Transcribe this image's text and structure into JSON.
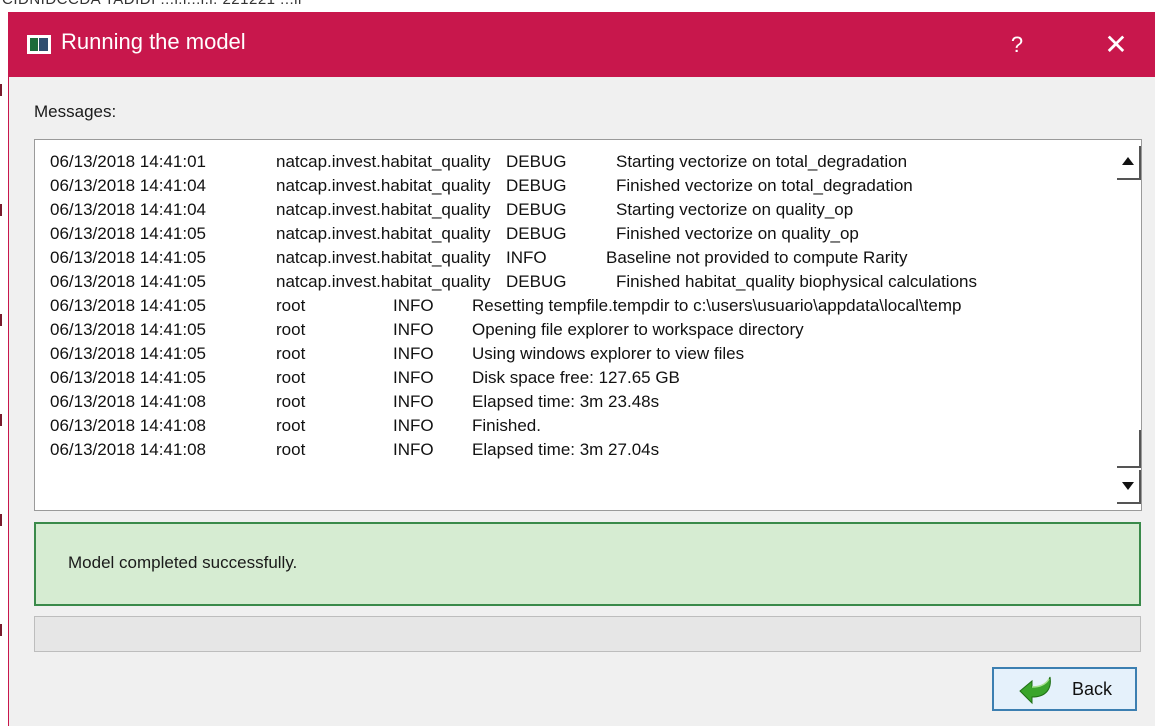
{
  "background_window": {
    "partial_text": "CIDNIDCCDA TADIDI ...l.l...l.l. 221221 ...ll"
  },
  "window": {
    "title": "Running the model",
    "help_label": "?",
    "close_label": "✕",
    "titlebar_color": "#c8174c"
  },
  "messages_label": "Messages:",
  "log": {
    "lines": [
      {
        "timestamp": "06/13/2018 14:41:01",
        "source": "natcap.invest.habitat_quality",
        "level": "DEBUG",
        "message": "Starting vectorize on total_degradation"
      },
      {
        "timestamp": "06/13/2018 14:41:04",
        "source": "natcap.invest.habitat_quality",
        "level": "DEBUG",
        "message": "Finished vectorize on total_degradation"
      },
      {
        "timestamp": "06/13/2018 14:41:04",
        "source": "natcap.invest.habitat_quality",
        "level": "DEBUG",
        "message": "Starting vectorize on quality_op"
      },
      {
        "timestamp": "06/13/2018 14:41:05",
        "source": "natcap.invest.habitat_quality",
        "level": "DEBUG",
        "message": "Finished vectorize on quality_op"
      },
      {
        "timestamp": "06/13/2018 14:41:05",
        "source": "natcap.invest.habitat_quality",
        "level": "INFO",
        "message": "Baseline not provided to compute Rarity"
      },
      {
        "timestamp": "06/13/2018 14:41:05",
        "source": "natcap.invest.habitat_quality",
        "level": "DEBUG",
        "message": "Finished habitat_quality biophysical calculations"
      },
      {
        "timestamp": "06/13/2018 14:41:05",
        "source": "root",
        "level": "INFO",
        "message": "Resetting tempfile.tempdir to c:\\users\\usuario\\appdata\\local\\temp"
      },
      {
        "timestamp": "06/13/2018 14:41:05",
        "source": "root",
        "level": "INFO",
        "message": "Opening file explorer to workspace directory"
      },
      {
        "timestamp": "06/13/2018 14:41:05",
        "source": "root",
        "level": "INFO",
        "message": "Using windows explorer to view files"
      },
      {
        "timestamp": "06/13/2018 14:41:05",
        "source": "root",
        "level": "INFO",
        "message": "Disk space free: 127.65 GB"
      },
      {
        "timestamp": "06/13/2018 14:41:08",
        "source": "root",
        "level": "INFO",
        "message": "Elapsed time: 3m 23.48s"
      },
      {
        "timestamp": "06/13/2018 14:41:08",
        "source": "root",
        "level": "INFO",
        "message": "Finished."
      },
      {
        "timestamp": "06/13/2018 14:41:08",
        "source": "root",
        "level": "INFO",
        "message": "Elapsed time: 3m 27.04s"
      }
    ]
  },
  "status": {
    "message": "Model completed successfully.",
    "background_color": "#d6ecd2",
    "border_color": "#3a8a4a"
  },
  "progress": {
    "value": 0
  },
  "back_button": {
    "label": "Back",
    "icon": "back-arrow-icon"
  }
}
